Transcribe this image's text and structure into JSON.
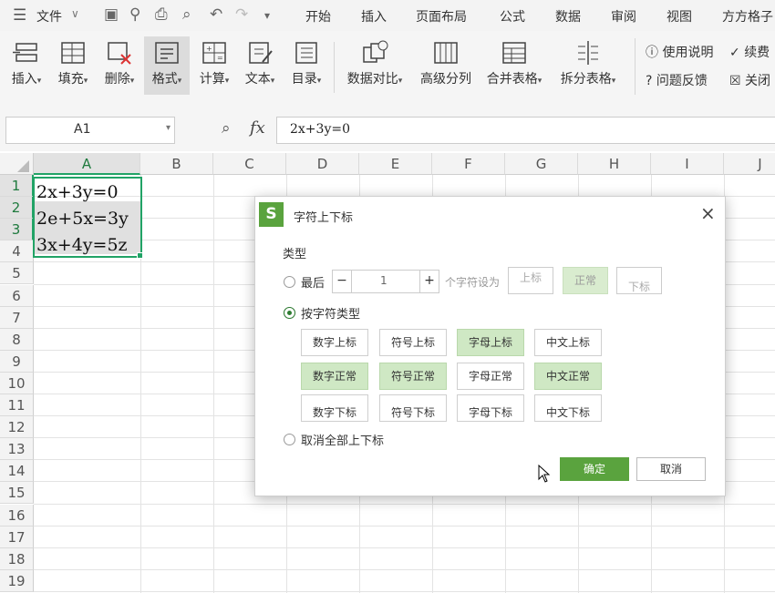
{
  "menubar": {
    "file_label": "文件",
    "tabs": [
      "开始",
      "插入",
      "页面布局",
      "公式",
      "数据",
      "审阅",
      "视图",
      "方方格子"
    ]
  },
  "ribbon": {
    "buttons": [
      {
        "label": "插入",
        "icon": "insert-icon"
      },
      {
        "label": "填充",
        "icon": "fill-icon"
      },
      {
        "label": "删除",
        "icon": "delete-icon"
      },
      {
        "label": "格式",
        "icon": "format-icon"
      },
      {
        "label": "计算",
        "icon": "calculate-icon"
      },
      {
        "label": "文本",
        "icon": "text-icon"
      },
      {
        "label": "目录",
        "icon": "catalog-icon"
      },
      {
        "label": "数据对比",
        "icon": "data-compare-icon"
      },
      {
        "label": "高级分列",
        "icon": "split-columns-icon"
      },
      {
        "label": "合并表格",
        "icon": "merge-table-icon"
      },
      {
        "label": "拆分表格",
        "icon": "split-table-icon"
      }
    ],
    "side": {
      "help": "使用说明",
      "renew": "续费",
      "feedback": "问题反馈",
      "close": "关闭"
    }
  },
  "formula_bar": {
    "cell_ref": "A1",
    "fx": "fx",
    "formula": "2x+3y=0"
  },
  "sheet": {
    "columns": [
      "A",
      "B",
      "C",
      "D",
      "E",
      "F",
      "G",
      "H",
      "I",
      "J"
    ],
    "rows": [
      "1",
      "2",
      "3",
      "4",
      "5",
      "6",
      "7",
      "8",
      "9",
      "10",
      "11",
      "12",
      "13",
      "14",
      "15",
      "16",
      "17",
      "18",
      "19"
    ],
    "cells": [
      "2x+3y=0",
      "2e+5x=3y",
      "3x+4y=5z"
    ]
  },
  "dialog": {
    "title": "字符上下标",
    "type_label": "类型",
    "last_label": "最后",
    "last_count": "1",
    "minus": "−",
    "plus": "+",
    "chars_set_as": "个字符设为",
    "btn_super": "上标",
    "btn_normal": "正常",
    "btn_sub": "下标",
    "by_type_label": "按字符类型",
    "grid": [
      [
        "数字上标",
        "符号上标",
        "字母上标",
        "中文上标"
      ],
      [
        "数字正常",
        "符号正常",
        "字母正常",
        "中文正常"
      ],
      [
        "数字下标",
        "符号下标",
        "字母下标",
        "中文下标"
      ]
    ],
    "cancel_all_label": "取消全部上下标",
    "ok": "确定",
    "cancel": "取消",
    "close": "×"
  },
  "colors": {
    "accent_green": "#5aa33e",
    "selected_cell_green": "#cfe8c4",
    "selection_border": "#21a366"
  }
}
